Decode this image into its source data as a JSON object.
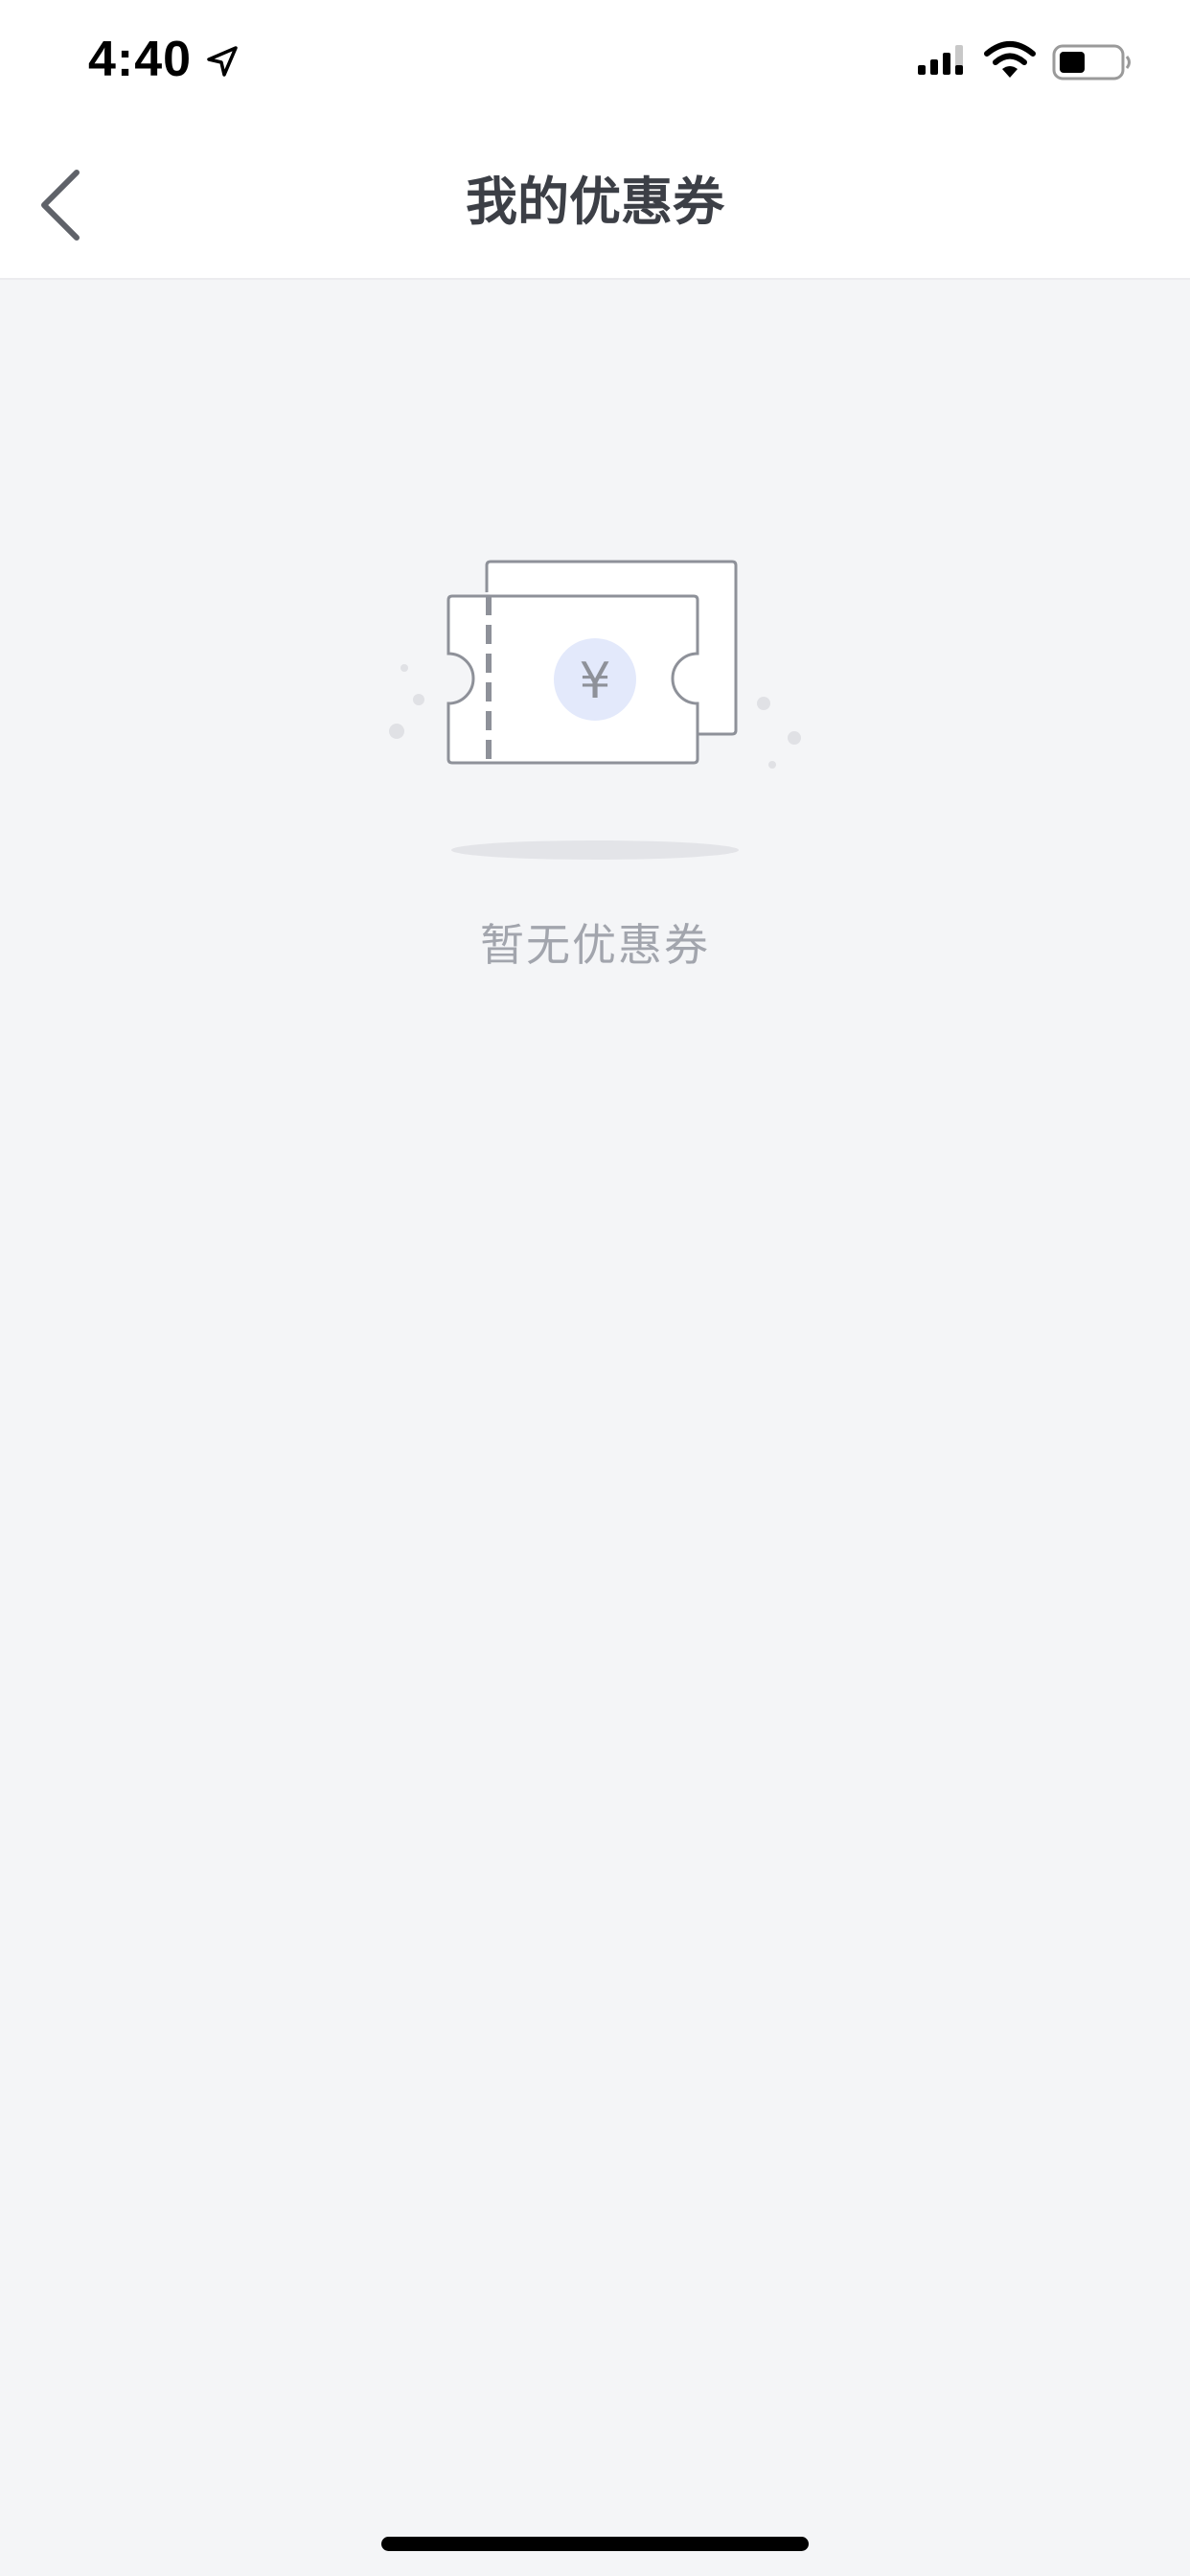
{
  "status_bar": {
    "time": "4:40"
  },
  "nav": {
    "title": "我的优惠券",
    "back_icon": "chevron-left-icon"
  },
  "empty_state": {
    "message": "暂无优惠券",
    "currency_symbol": "¥",
    "illustration": "coupon-ticket-icon"
  },
  "colors": {
    "background": "#f4f5f7",
    "title": "#3c3f46",
    "muted_text": "#a2a5ad",
    "ticket_outline": "#8e9199",
    "coin_fill": "#e3e9fb"
  }
}
